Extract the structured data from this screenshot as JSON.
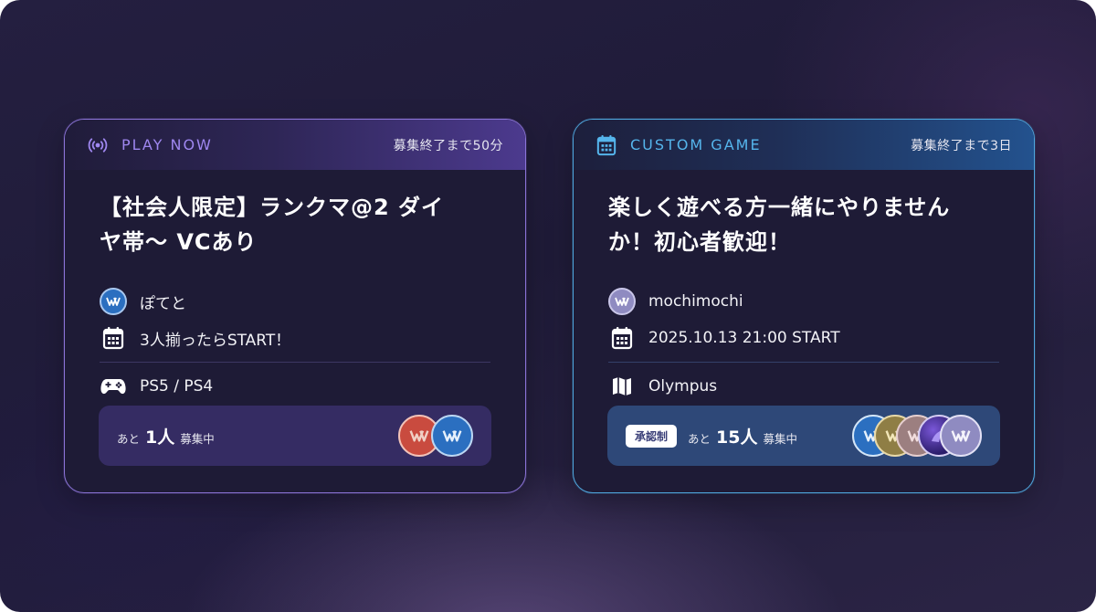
{
  "cards": [
    {
      "type_label": "PLAY NOW",
      "type_icon": "broadcast-icon",
      "deadline": "募集終了まで50分",
      "title_line1": "【社会人限定】ランクマ@2 ダイ",
      "title_line2": "ヤ帯〜 VCあり",
      "host": "ぽてと",
      "schedule": "3人揃ったらSTART！",
      "platform": "PS5 / PS4",
      "footer": {
        "prefix": "あと",
        "count": "1人",
        "suffix": "募集中"
      },
      "accent": "#8a73d6"
    },
    {
      "type_label": "CUSTOM GAME",
      "type_icon": "calendar-icon",
      "deadline": "募集終了まで3日",
      "title_line1": "楽しく遊べる方一緒にやりません",
      "title_line2": "か！初心者歓迎！",
      "host": "mochimochi",
      "schedule": "2025.10.13 21:00 START",
      "map": "Olympus",
      "footer": {
        "badge": "承認制",
        "prefix": "あと",
        "count": "15人",
        "suffix": "募集中"
      },
      "accent": "#4fa6dd"
    }
  ]
}
